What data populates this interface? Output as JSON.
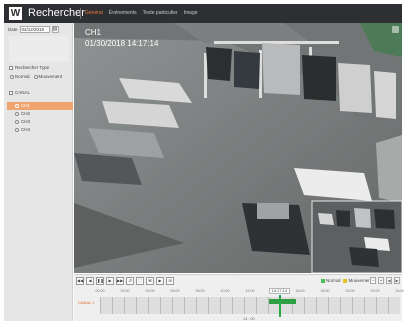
{
  "window": {
    "title": "Rechercher",
    "tabs": [
      "Général",
      "Événements",
      "Texte particulier",
      "Image"
    ]
  },
  "sidebar": {
    "date_label": "Date",
    "date_value": "02/12/2018",
    "search_type_label": "Rechercher Type",
    "options": [
      {
        "label": "Normal"
      },
      {
        "label": "Mouvement"
      }
    ],
    "channel_header": "CANAL",
    "channels": [
      "CH1",
      "CH2",
      "CH3",
      "CH4"
    ]
  },
  "video": {
    "channel": "CH1",
    "timestamp": "01/30/2018  14:17:14"
  },
  "playback": {
    "buttons": [
      "◀◀",
      "◀",
      "❚❚",
      "▶",
      "▶▶",
      "↺",
      "⛶",
      "⌘",
      "▶",
      "⊞"
    ],
    "legend": [
      {
        "label": "Normal",
        "color": "#4dbd5b"
      },
      {
        "label": "Mouvement",
        "color": "#e0c21a"
      }
    ],
    "zoom_buttons": [
      "−",
      "+",
      "◀",
      "▶"
    ],
    "scale_labels": [
      "00:00",
      "02:00",
      "04:00",
      "06:00",
      "08:00",
      "10:00",
      "12:00",
      "14:00",
      "16:00",
      "18:00",
      "20:00",
      "22:00",
      "24:00"
    ],
    "current_time": "14:17:14",
    "row_label": "CANAL 1",
    "recording": [
      {
        "start": "13:30",
        "end": "15:40"
      }
    ]
  },
  "colors": {
    "accent": "#e87b3d",
    "record_bar": "#2ea043"
  },
  "bottom_label": "14 : 00"
}
